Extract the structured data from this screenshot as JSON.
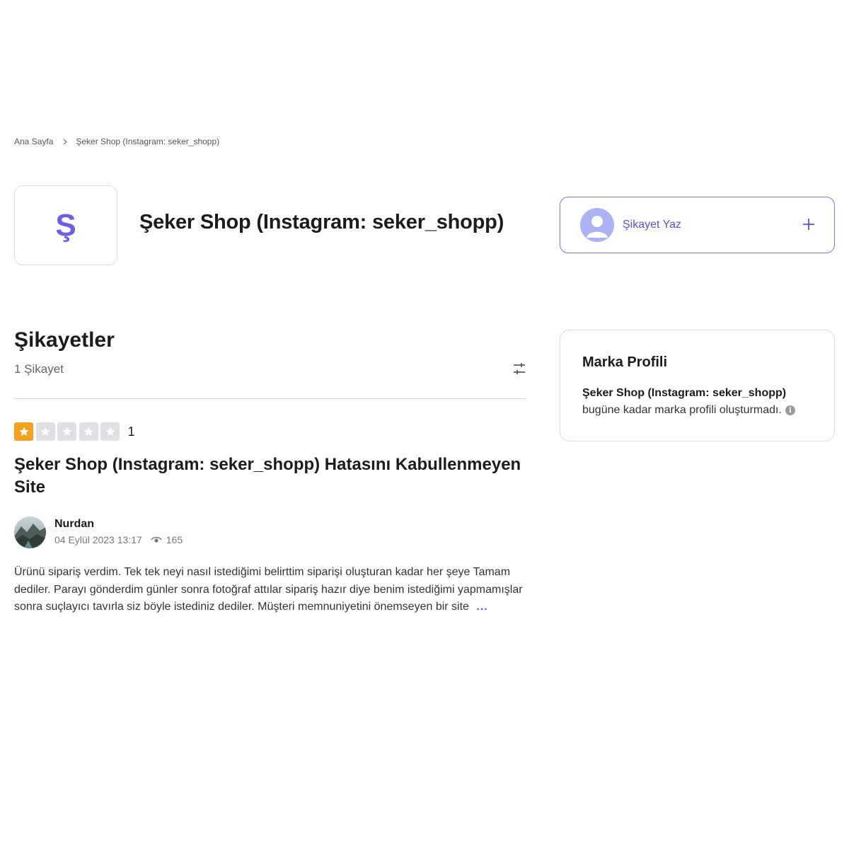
{
  "breadcrumb": {
    "home": "Ana Sayfa",
    "current": "Şeker Shop (Instagram: seker_shopp)"
  },
  "brand": {
    "logo_letter": "Ş",
    "title": "Şeker Shop (Instagram: seker_shopp)"
  },
  "write_complaint": {
    "label": "Şikayet Yaz",
    "icon": "plus-icon"
  },
  "complaints": {
    "title": "Şikayetler",
    "count": "1 Şikayet",
    "filter_icon": "sliders-icon"
  },
  "complaint": {
    "rating": 1,
    "rating_max": 5,
    "rating_label": "1",
    "title": "Şeker Shop (Instagram: seker_shopp) Hatasını Kabullenmeyen Site",
    "user": "Nurdan",
    "date": "04 Eylül 2023 13:17",
    "views": "165",
    "body": "Ürünü sipariş verdim. Tek tek neyi nasıl istediğimi belirttim siparişi oluşturan kadar her şeye Tamam dediler. Parayı gönderdim günler sonra fotoğraf attılar sipariş hazır diye benim istediğimi yapmamışlar sonra suçlayıcı tavırla siz böyle istediniz dediler. Müşteri memnuniyetini önemseyen bir site",
    "more": "..."
  },
  "brand_profile": {
    "title": "Marka Profili",
    "brand": "Şeker Shop (Instagram: seker_shopp)",
    "text": "bugüne kadar marka profili oluşturmadı.",
    "info_icon": "i"
  },
  "colors": {
    "accent": "#5b4ee0",
    "star_filled": "#f5a21a",
    "star_empty": "#e0e0e4"
  }
}
